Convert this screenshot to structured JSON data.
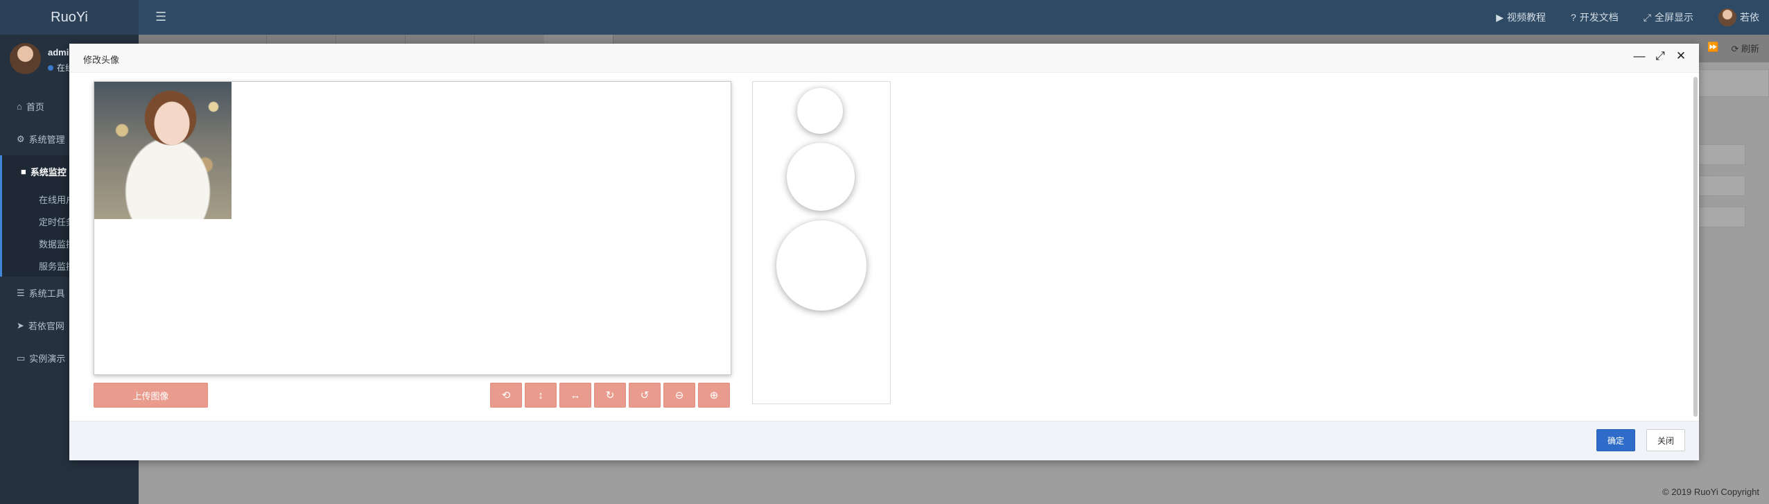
{
  "app": {
    "logo": "RuoYi"
  },
  "topbar": {
    "menu_icon": "hamburger-icon",
    "items": [
      {
        "icon": "video-icon",
        "glyph": "▶",
        "label": "视频教程"
      },
      {
        "icon": "help-icon",
        "glyph": "?",
        "label": "开发文档"
      },
      {
        "icon": "fullscreen-icon",
        "glyph": "⤢",
        "label": "全屏显示"
      }
    ],
    "user": {
      "name": "若依"
    }
  },
  "tabstrip": {
    "forward_glyph": "⏩",
    "refresh_label": "⟳ 刷新"
  },
  "sidebar": {
    "user": {
      "name": "admin",
      "status": "在线"
    },
    "menu": [
      {
        "icon": "home-icon",
        "glyph": "⌂",
        "label": "首页"
      },
      {
        "icon": "gear-icon",
        "glyph": "⚙",
        "label": "系统管理"
      },
      {
        "icon": "camera-icon",
        "glyph": "■",
        "label": "系统监控"
      },
      {
        "icon": "bars-icon",
        "glyph": "☰",
        "label": "系统工具"
      },
      {
        "icon": "send-icon",
        "glyph": "➤",
        "label": "若依官网"
      },
      {
        "icon": "desktop-icon",
        "glyph": "▭",
        "label": "实例演示"
      }
    ],
    "submenu": [
      "在线用户",
      "定时任务",
      "数据监控",
      "服务监控"
    ]
  },
  "modal": {
    "title": "修改头像",
    "controls": {
      "minimize": "—",
      "maximize": "⤢",
      "close": "✕"
    },
    "upload_label": "上传图像",
    "tools": [
      {
        "name": "refresh-icon",
        "glyph": "⟲"
      },
      {
        "name": "flip-vertical-icon",
        "glyph": "↕"
      },
      {
        "name": "flip-horizontal-icon",
        "glyph": "↔"
      },
      {
        "name": "rotate-right-icon",
        "glyph": "↻"
      },
      {
        "name": "rotate-left-icon",
        "glyph": "↺"
      },
      {
        "name": "zoom-out-icon",
        "glyph": "⊖"
      },
      {
        "name": "zoom-in-icon",
        "glyph": "⊕"
      }
    ],
    "confirm_label": "确定",
    "cancel_label": "关闭"
  },
  "footer": {
    "copyright": "© 2019 RuoYi Copyright"
  },
  "colors": {
    "topbar": "#2f4a64",
    "sidebar": "#25313f",
    "accent": "#3f86d9",
    "tool_button": "#e99b8e",
    "primary": "#2f6bc8"
  }
}
